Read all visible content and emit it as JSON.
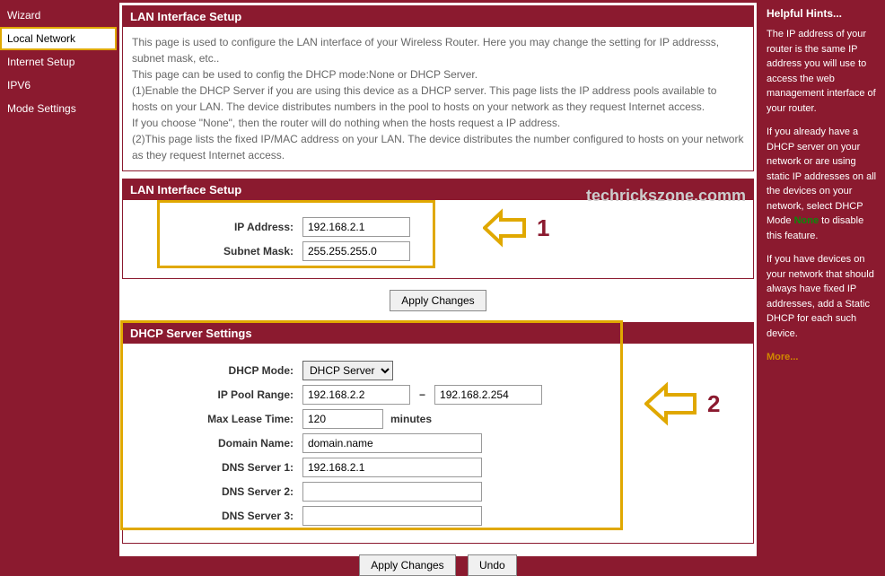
{
  "sidebar": {
    "items": [
      {
        "label": "Wizard"
      },
      {
        "label": "Local Network"
      },
      {
        "label": "Internet Setup"
      },
      {
        "label": "IPV6"
      },
      {
        "label": "Mode Settings"
      }
    ],
    "active_index": 1
  },
  "page": {
    "title": "LAN Interface Setup",
    "desc_lines": [
      "This page is used to configure the LAN interface of your Wireless Router. Here you may change the setting for IP addresss, subnet mask, etc..",
      "This page can be used to config the DHCP mode:None or DHCP Server.",
      "(1)Enable the DHCP Server if you are using this device as a DHCP server. This page lists the IP address pools available to hosts on your LAN. The device distributes numbers in the pool to hosts on your network as they request Internet access.",
      "If you choose \"None\", then the router will do nothing when the hosts request a IP address.",
      "(2)This page lists the fixed IP/MAC address on your LAN. The device distributes the number configured to hosts on your network as they request Internet access."
    ]
  },
  "lan": {
    "section_title": "LAN Interface Setup",
    "ip_label": "IP Address:",
    "ip_value": "192.168.2.1",
    "mask_label": "Subnet Mask:",
    "mask_value": "255.255.255.0"
  },
  "dhcp": {
    "section_title": "DHCP Server Settings",
    "mode_label": "DHCP Mode:",
    "mode_value": "DHCP Server",
    "pool_label": "IP Pool Range:",
    "pool_start": "192.168.2.2",
    "pool_end": "192.168.2.254",
    "lease_label": "Max Lease Time:",
    "lease_value": "120",
    "lease_unit": "minutes",
    "domain_label": "Domain Name:",
    "domain_value": "domain.name",
    "dns1_label": "DNS Server 1:",
    "dns1_value": "192.168.2.1",
    "dns2_label": "DNS Server 2:",
    "dns2_value": "",
    "dns3_label": "DNS Server 3:",
    "dns3_value": ""
  },
  "buttons": {
    "apply": "Apply Changes",
    "undo": "Undo"
  },
  "hints": {
    "title": "Helpful Hints...",
    "p1": "The IP address of your router is the same IP address you will use to access the web management interface of your router.",
    "p2_pre": "If you already have a DHCP server on your network or are using static IP addresses on all the devices on your network, select DHCP Mode ",
    "p2_none": "None",
    "p2_post": " to disable this feature.",
    "p3": "If you have devices on your network that should always have fixed IP addresses, add a Static DHCP for each such device.",
    "more": "More..."
  },
  "annotations": {
    "num1": "1",
    "num2": "2",
    "dash": "−",
    "watermark": "techrickszone.comm"
  },
  "colors": {
    "brand": "#8b1a2f",
    "highlight": "#e0a800"
  }
}
